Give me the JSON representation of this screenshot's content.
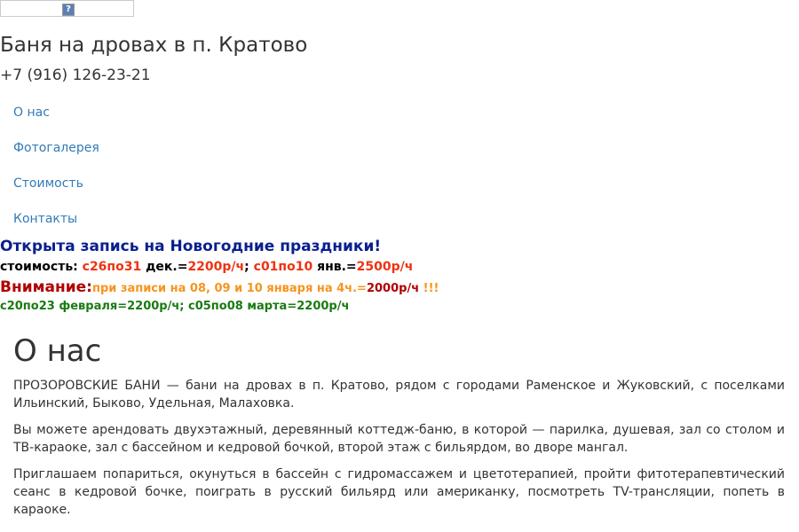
{
  "banner": {
    "icon": "broken-image-icon",
    "glyph": "?"
  },
  "header": {
    "title": "Баня на дровах в п. Кратово",
    "phone": "+7 (916) 126-23-21"
  },
  "nav": {
    "items": [
      {
        "label": "О нас"
      },
      {
        "label": "Фотогалерея"
      },
      {
        "label": "Стоимость"
      },
      {
        "label": "Контакты"
      }
    ]
  },
  "promo": {
    "headline": "Открыта запись на Новогодние праздники!",
    "price_line": {
      "label": "стоимость: ",
      "range1": "с26по31",
      "month1": " дек.=",
      "price1": "2200р/ч",
      "sep": "; ",
      "range2": "с01по10",
      "month2": " янв.=",
      "price2": "2500р/ч"
    },
    "attention": {
      "label": "Внимание:",
      "text": "при записи на 08, 09 и 10 января на 4ч.=",
      "price": "2000р/ч",
      "exclaim": " !!!"
    },
    "feb_march": "с20по23 февраля=2200р/ч; с05по08 марта=2200р/ч"
  },
  "about": {
    "title": "О нас",
    "paragraphs": [
      "ПРОЗОРОВСКИЕ БАНИ — бани на дровах в п. Кратово, рядом с городами Раменское и Жуковский, с поселками Ильинский, Быково, Удельная, Малаховка.",
      "Вы можете арендовать двухэтажный, деревянный коттедж-баню, в которой — парилка, душевая, зал со столом и ТВ-караоке, зал с бассейном и кедровой бочкой, второй этаж с бильярдом, во дворе мангал.",
      "Приглашаем попариться, окунуться в бассейн с гидромассажем и цветотерапией, пройти фитотерапевтический сеанс в кедровой бочке, поиграть в русский бильярд или американку, посмотреть TV-трансляции, попеть в караоке."
    ]
  },
  "colors": {
    "link": "#337ab7",
    "headline_blue": "#0a1f8f",
    "price_red": "#ee3311",
    "attention_red": "#b00000",
    "attention_orange": "#f7941d",
    "green": "#1a7a12"
  }
}
